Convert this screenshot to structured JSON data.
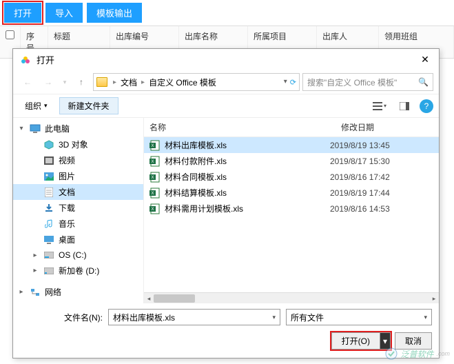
{
  "toolbar": {
    "open": "打开",
    "import": "导入",
    "template_output": "模板输出"
  },
  "grid": {
    "seq": "序号",
    "title": "标题",
    "code": "出库编号",
    "name": "出库名称",
    "project": "所属项目",
    "person": "出库人",
    "team": "领用班组"
  },
  "dialog": {
    "title": "打开",
    "path": {
      "crumb1": "文档",
      "crumb2": "自定义 Office 模板"
    },
    "search_placeholder": "搜索\"自定义 Office 模板\"",
    "organize": "组织",
    "new_folder": "新建文件夹",
    "columns": {
      "name": "名称",
      "date": "修改日期"
    },
    "tree": {
      "this_pc": "此电脑",
      "objects3d": "3D 对象",
      "videos": "视频",
      "pictures": "图片",
      "documents": "文档",
      "downloads": "下载",
      "music": "音乐",
      "desktop": "桌面",
      "os_c": "OS (C:)",
      "vol_d": "新加卷 (D:)",
      "network": "网络"
    },
    "files": [
      {
        "name": "材料出库模板.xls",
        "date": "2019/8/19 13:45",
        "selected": true
      },
      {
        "name": "材料付款附件.xls",
        "date": "2019/8/17 15:30",
        "selected": false
      },
      {
        "name": "材料合同模板.xls",
        "date": "2019/8/16 17:42",
        "selected": false
      },
      {
        "name": "材料结算模板.xls",
        "date": "2019/8/19 17:44",
        "selected": false
      },
      {
        "name": "材料需用计划模板.xls",
        "date": "2019/8/16 14:53",
        "selected": false
      }
    ],
    "filename_label": "文件名(N):",
    "filename_value": "材料出库模板.xls",
    "filter": "所有文件",
    "open_btn": "打开(O)",
    "cancel_btn": "取消"
  },
  "watermark": "泛普软件"
}
